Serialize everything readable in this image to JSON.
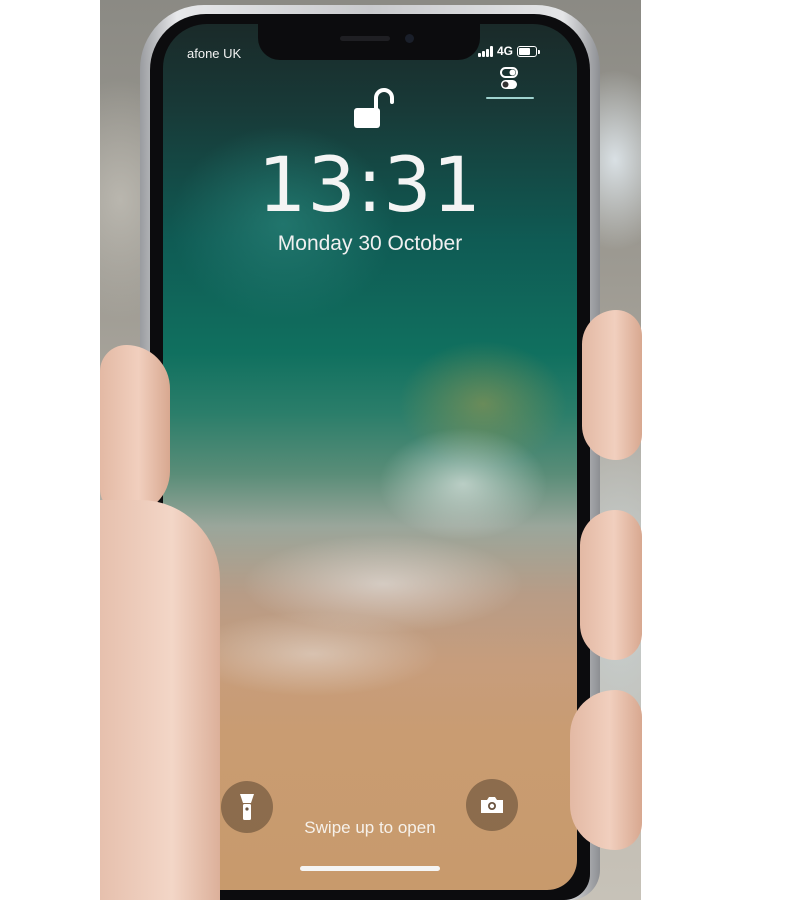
{
  "status_bar": {
    "carrier": "afone UK",
    "network": "4G"
  },
  "lock_screen": {
    "time": "13:31",
    "date": "Monday 30 October",
    "swipe_hint": "Swipe up to open"
  },
  "icons": {
    "lock": "unlocked-padlock-icon",
    "control_center": "control-center-icon",
    "torch": "flashlight-icon",
    "camera": "camera-icon"
  }
}
